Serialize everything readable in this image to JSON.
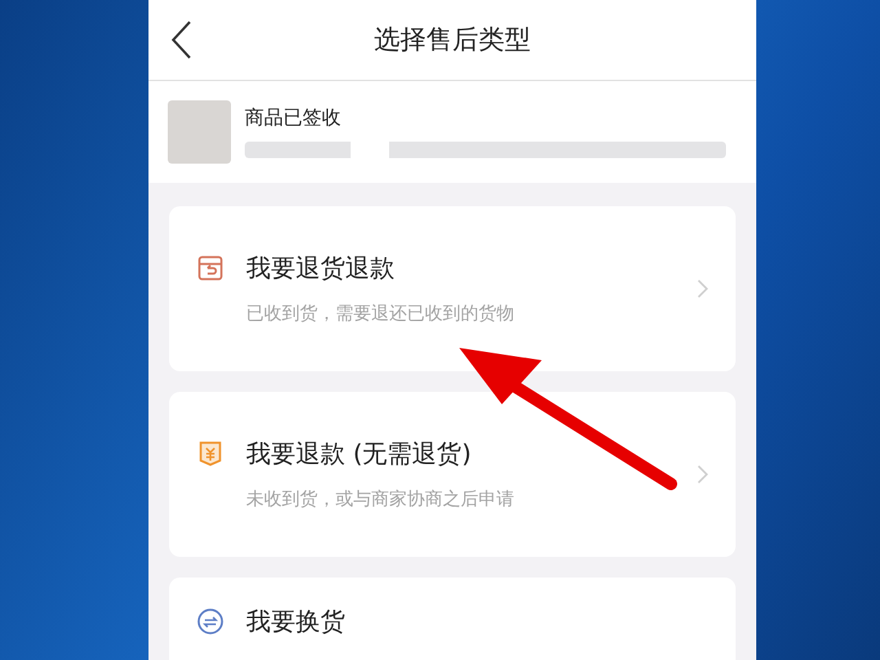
{
  "header": {
    "title": "选择售后类型"
  },
  "product": {
    "status": "商品已签收"
  },
  "options": [
    {
      "kind": "return-refund",
      "title": "我要退货退款",
      "subtitle": "已收到货，需要退还已收到的货物"
    },
    {
      "kind": "refund-only",
      "title": "我要退款 (无需退货)",
      "subtitle": "未收到货，或与商家协商之后申请"
    },
    {
      "kind": "exchange",
      "title": "我要换货"
    }
  ]
}
